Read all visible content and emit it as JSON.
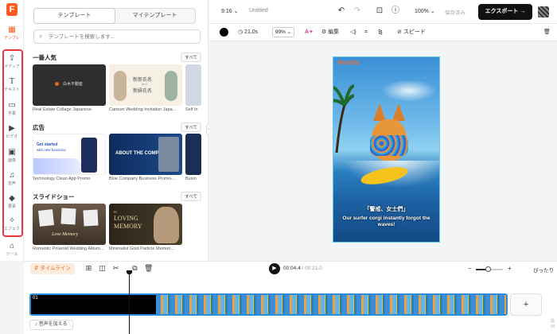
{
  "colors": {
    "accent": "#ff5a1f",
    "highlight": "#e03a3a",
    "track": "#2a8de0",
    "export_bg": "#111111"
  },
  "rail": {
    "logo": "F",
    "items": [
      {
        "label": "テンプレ",
        "icon": "template-icon",
        "glyph": "▦",
        "active": true
      },
      {
        "label": "メディア",
        "icon": "media-upload-icon",
        "glyph": "⇪"
      },
      {
        "label": "テキスト",
        "icon": "text-icon",
        "glyph": "T"
      },
      {
        "label": "字幕",
        "icon": "subtitle-icon",
        "glyph": "▭"
      },
      {
        "label": "ビデオ",
        "icon": "video-icon",
        "glyph": "▶"
      },
      {
        "label": "画像",
        "icon": "image-icon",
        "glyph": "▣"
      },
      {
        "label": "音声",
        "icon": "music-icon",
        "glyph": "♫"
      },
      {
        "label": "要素",
        "icon": "elements-icon",
        "glyph": "◆"
      },
      {
        "label": "エフェク",
        "icon": "effects-icon",
        "glyph": "✧"
      },
      {
        "label": "ツール",
        "icon": "tools-icon",
        "glyph": "⌂"
      }
    ]
  },
  "panel": {
    "tabs": [
      "テンプレート",
      "マイテンプレート"
    ],
    "search_placeholder": "テンプレートを検索します...",
    "see_all": "すべて",
    "sections": [
      {
        "title": "一番人気",
        "cards": [
          "Real Estate Collage Japanese",
          "Cartoon Wedding Invitation Japa...",
          "Self In"
        ]
      },
      {
        "title": "広告",
        "cards": [
          "Technology Clean App Promo",
          "Blue Company Business Promo-...",
          "Busin"
        ]
      },
      {
        "title": "スライドショー",
        "cards": [
          "Romantic Polaroid Wedding Album...",
          "Minimalist Gold Particle Memori...",
          ""
        ]
      }
    ],
    "thumb_text": {
      "brand_jp": "白木不動産",
      "wedding_line1": "新郎氏名",
      "wedding_amp": "and",
      "wedding_line2": "新婦氏名",
      "tech_line1": "Get started",
      "tech_line2": "with new functions",
      "company_line1": "ABOUT THE COMPANY",
      "memory_script": "Love Memory",
      "loving_line1": "In",
      "loving_line2": "LOVING",
      "loving_line3": "MEMORY"
    }
  },
  "topbar": {
    "aspect": "9:16",
    "title": "Untitled",
    "zoom": "100%",
    "saved": "保存済み",
    "export": "エクスポート"
  },
  "edit_toolbar": {
    "duration": "21.0s",
    "opacity": "99%",
    "edit": "編集",
    "speed": "スピード"
  },
  "canvas": {
    "brand": "FlexClip",
    "subtitle_jp": "「警戒、女士們」",
    "subtitle_en": "Our surfer corgi instantly forgot the waves!"
  },
  "timeline": {
    "tab": "タイムライン",
    "current": "00:04.4",
    "total": "/ 00:21.0",
    "fit": "ぴったり",
    "clip_index": "01",
    "add_audio": "音声を加える",
    "zoom_level": 0.45,
    "side_peek": "激\n99"
  }
}
